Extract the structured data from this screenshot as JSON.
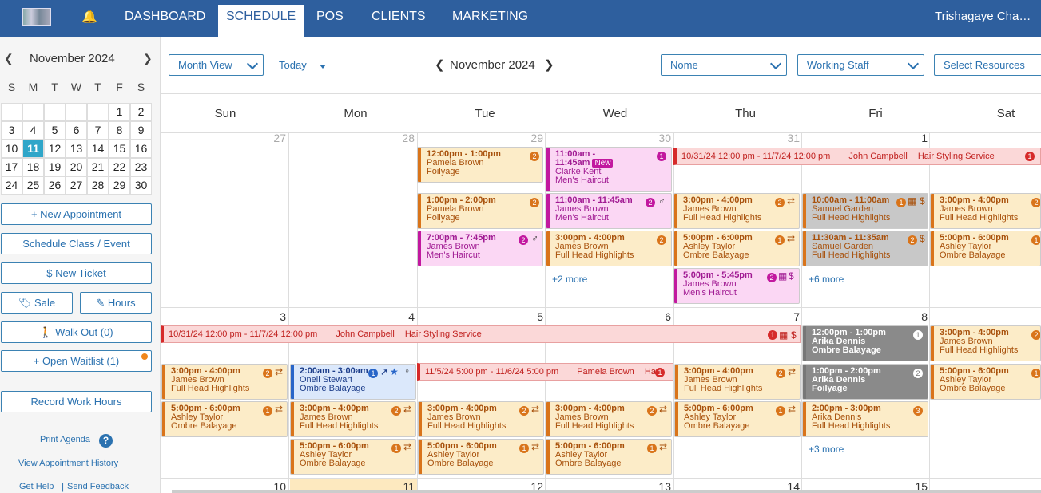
{
  "nav": {
    "items": [
      "DASHBOARD",
      "SCHEDULE",
      "POS",
      "CLIENTS",
      "MARKETING"
    ],
    "active": "SCHEDULE",
    "user": "Trishagaye Cha…"
  },
  "mini_cal": {
    "title": "November 2024",
    "dow": [
      "S",
      "M",
      "T",
      "W",
      "T",
      "F",
      "S"
    ],
    "rows": [
      [
        "",
        "",
        "",
        "",
        "",
        "1",
        "2"
      ],
      [
        "3",
        "4",
        "5",
        "6",
        "7",
        "8",
        "9"
      ],
      [
        "10",
        "11",
        "12",
        "13",
        "14",
        "15",
        "16"
      ],
      [
        "17",
        "18",
        "19",
        "20",
        "21",
        "22",
        "23"
      ],
      [
        "24",
        "25",
        "26",
        "27",
        "28",
        "29",
        "30"
      ]
    ],
    "today": "11"
  },
  "sidebar": {
    "new_appt": "+ New Appointment",
    "schedule_class": "Schedule Class / Event",
    "new_ticket": "$  New Ticket",
    "sale": "Sale",
    "hours": "Hours",
    "walk_out": "Walk Out (0)",
    "open_waitlist": "+ Open Waitlist (1)",
    "record_hours": "Record Work Hours",
    "print_agenda": "Print Agenda",
    "view_history": "View Appointment History",
    "get_help": "Get Help",
    "send_feedback": "Send Feedback"
  },
  "toolbar": {
    "view": "Month View",
    "today": "Today",
    "title": "November 2024",
    "filter1": "Nome",
    "filter2": "Working Staff",
    "filter3": "Select Resources"
  },
  "days": [
    "Sun",
    "Mon",
    "Tue",
    "Wed",
    "Thu",
    "Fri",
    "Sat"
  ],
  "week1_nums": [
    "27",
    "28",
    "29",
    "30",
    "31",
    "1"
  ],
  "week2_nums": [
    "3",
    "4",
    "5",
    "6",
    "7",
    "8"
  ],
  "week3_nums": [
    "10",
    "11",
    "12",
    "13",
    "14",
    "15"
  ],
  "span1": {
    "time": "10/31/24 12:00 pm - 11/7/24 12:00 pm",
    "client": "John Campbell",
    "service": "Hair Styling Service"
  },
  "span2": {
    "time": "11/5/24 5:00 pm - 11/6/24 5:00 pm",
    "client": "Pamela Brown",
    "service": "Ha"
  },
  "events": {
    "tue1": {
      "time": "12:00pm - 1:00pm",
      "client": "Pamela Brown",
      "service": "Foilyage"
    },
    "tue2": {
      "time": "1:00pm - 2:00pm",
      "client": "Pamela Brown",
      "service": "Foilyage"
    },
    "tue3": {
      "time": "7:00pm - 7:45pm",
      "client": "James Brown",
      "service": "Men's Haircut"
    },
    "wed1": {
      "time": "11:00am -",
      "time2": "11:45am",
      "tag": "New",
      "client": "Clarke Kent",
      "service": "Men's Haircut"
    },
    "wed2": {
      "time": "11:00am - 11:45am",
      "client": "James Brown",
      "service": "Men's Haircut"
    },
    "wed3": {
      "time": "3:00pm - 4:00pm",
      "client": "James Brown",
      "service": "Full Head Highlights"
    },
    "wed_more": "+2 more",
    "thu1": {
      "time": "3:00pm - 4:00pm",
      "client": "James Brown",
      "service": "Full Head Highlights"
    },
    "thu2": {
      "time": "5:00pm - 6:00pm",
      "client": "Ashley Taylor",
      "service": "Ombre Balayage"
    },
    "thu3": {
      "time": "5:00pm - 5:45pm",
      "client": "James Brown",
      "service": "Men's Haircut"
    },
    "fri1": {
      "time": "10:00am - 11:00am",
      "client": "Samuel Garden",
      "service": "Full Head Highlights"
    },
    "fri2": {
      "time": "11:30am - 11:35am",
      "client": "Samuel Garden",
      "service": "Full Head Highlights"
    },
    "fri_more": "+6 more",
    "sat1": {
      "time": "3:00pm - 4:00pm",
      "client": "James Brown",
      "service": "Full Head Highlights"
    },
    "sat2": {
      "time": "5:00pm - 6:00pm",
      "client": "Ashley Taylor",
      "service": "Ombre Balayage"
    },
    "w2sun1": {
      "time": "3:00pm - 4:00pm",
      "client": "James Brown",
      "service": "Full Head Highlights"
    },
    "w2sun2": {
      "time": "5:00pm - 6:00pm",
      "client": "Ashley Taylor",
      "service": "Ombre Balayage"
    },
    "w2mon1": {
      "time": "2:00am - 3:00am",
      "client": "Oneil Stewart",
      "service": "Ombre Balayage"
    },
    "w2mon2": {
      "time": "3:00pm - 4:00pm",
      "client": "James Brown",
      "service": "Full Head Highlights"
    },
    "w2mon3": {
      "time": "5:00pm - 6:00pm",
      "client": "Ashley Taylor",
      "service": "Ombre Balayage"
    },
    "w2tue1": {
      "time": "3:00pm - 4:00pm",
      "client": "James Brown",
      "service": "Full Head Highlights"
    },
    "w2tue2": {
      "time": "5:00pm - 6:00pm",
      "client": "Ashley Taylor",
      "service": "Ombre Balayage"
    },
    "w2wed1": {
      "time": "3:00pm - 4:00pm",
      "client": "James Brown",
      "service": "Full Head Highlights"
    },
    "w2wed2": {
      "time": "5:00pm - 6:00pm",
      "client": "Ashley Taylor",
      "service": "Ombre Balayage"
    },
    "w2thu1": {
      "time": "3:00pm - 4:00pm",
      "client": "James Brown",
      "service": "Full Head Highlights"
    },
    "w2thu2": {
      "time": "5:00pm - 6:00pm",
      "client": "Ashley Taylor",
      "service": "Ombre Balayage"
    },
    "w2fri1": {
      "time": "12:00pm - 1:00pm",
      "client": "Arika Dennis",
      "service": "Ombre Balayage"
    },
    "w2fri2": {
      "time": "1:00pm - 2:00pm",
      "client": "Arika Dennis",
      "service": "Foilyage"
    },
    "w2fri3": {
      "time": "2:00pm - 3:00pm",
      "client": "Arika Dennis",
      "service": "Full Head Highlights"
    },
    "w2fri_more": "+3 more",
    "w2sat1": {
      "time": "3:00pm - 4:00pm",
      "client": "James Brown",
      "service": "Full Head Highlights"
    },
    "w2sat2": {
      "time": "5:00pm - 6:00pm",
      "client": "Ashley Taylor",
      "service": "Ombre Balayage"
    }
  },
  "badges": {
    "one": "1",
    "two": "2",
    "three": "3"
  }
}
